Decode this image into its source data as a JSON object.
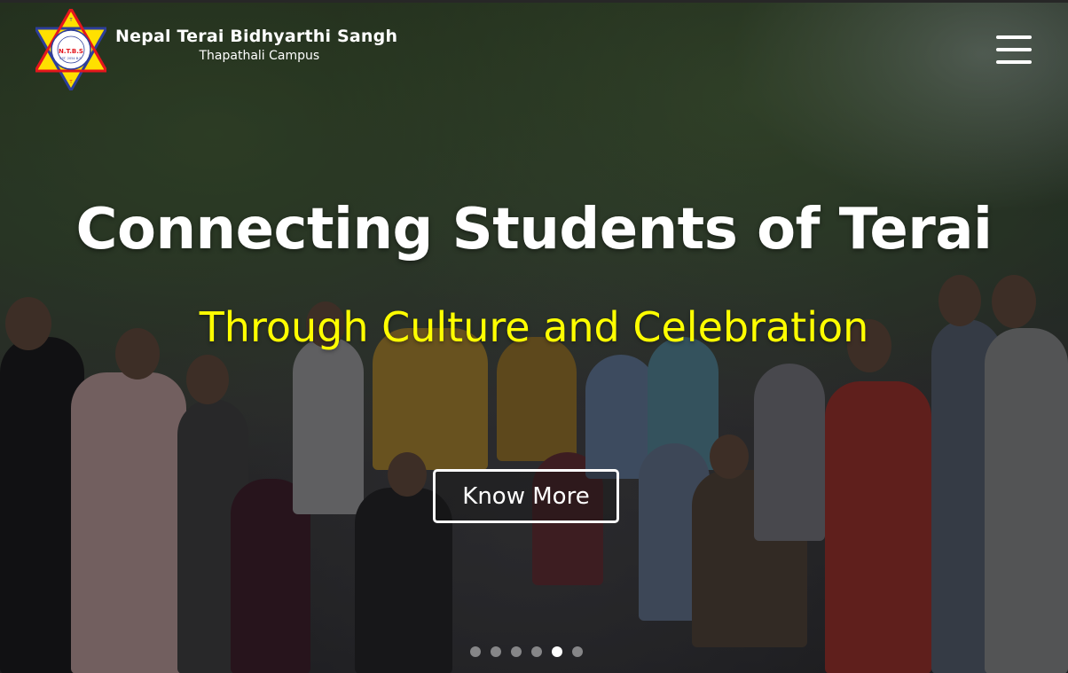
{
  "header": {
    "logo": {
      "icon": "ntbs-star-logo-icon",
      "badge_text": "N.T.B.S",
      "est_text": "EST. 2054 B.S."
    },
    "brand_name": "Nepal Terai Bidhyarthi Sangh",
    "brand_sub": "Thapathali Campus",
    "menu_icon": "hamburger-menu-icon"
  },
  "hero": {
    "headline": "Connecting Students of Terai",
    "subheadline": "Through Culture and Celebration",
    "cta_label": "Know More",
    "slides": {
      "count": 6,
      "active_index": 5
    }
  },
  "colors": {
    "headline": "#ffffff",
    "subheadline": "#ffff00",
    "logo_red": "#e4161d",
    "logo_blue": "#2d3e9b",
    "logo_yellow": "#ffe000"
  }
}
